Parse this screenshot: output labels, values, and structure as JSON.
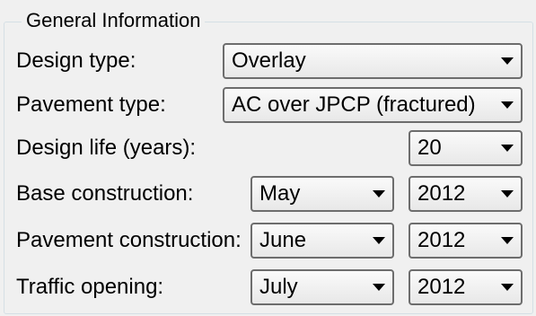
{
  "group": {
    "title": "General Information"
  },
  "rows": {
    "design_type": {
      "label": "Design type:",
      "value": "Overlay"
    },
    "pavement_type": {
      "label": "Pavement type:",
      "value": "AC over JPCP (fractured)"
    },
    "design_life": {
      "label": "Design life (years):",
      "value": "20"
    },
    "base_construction": {
      "label": "Base construction:",
      "month": "May",
      "year": "2012"
    },
    "pavement_construction": {
      "label": "Pavement construction:",
      "month": "June",
      "year": "2012"
    },
    "traffic_opening": {
      "label": "Traffic opening:",
      "month": "July",
      "year": "2012"
    }
  },
  "icons": {
    "dropdown": "chevron-down-icon"
  }
}
